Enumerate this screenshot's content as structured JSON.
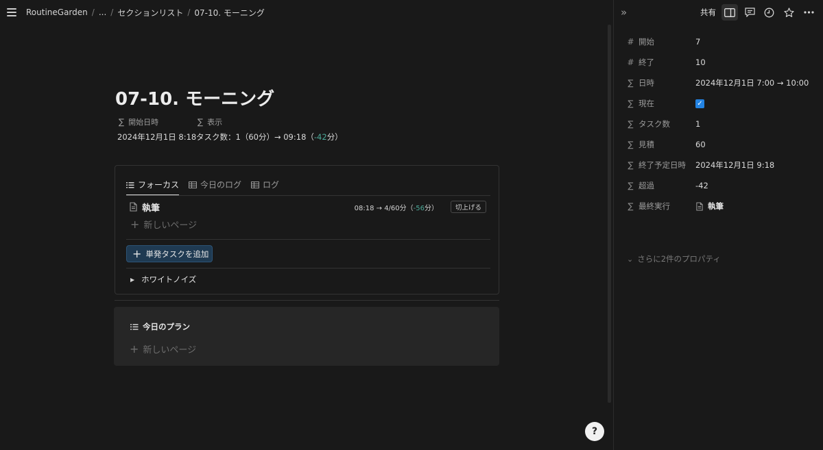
{
  "breadcrumb": [
    "RoutineGarden",
    "...",
    "セクションリスト",
    "07-10. モーニング"
  ],
  "page": {
    "title": "07-10. モーニング",
    "props": [
      {
        "name": "開始日時",
        "value": "2024年12月1日 8:18"
      },
      {
        "name": "表示",
        "value_a": "タスク数：1（60分）→ 09:18（",
        "value_green": "-42",
        "value_b": "分）"
      }
    ]
  },
  "focus_panel": {
    "tabs": [
      "フォーカス",
      "今日のログ",
      "ログ"
    ],
    "task": {
      "name": "執筆",
      "info_a": "08:18 → 4/60分（",
      "info_green": "-56",
      "info_b": "分）",
      "button": "切上げる"
    },
    "new_page": "新しいページ",
    "add_button": "単発タスクを追加",
    "toggle": "ホワイトノイズ"
  },
  "plan_panel": {
    "title": "今日のプラン",
    "new_page": "新しいページ"
  },
  "help_button": "?",
  "right_panel": {
    "share": "共有",
    "properties": [
      {
        "icon": "#",
        "name": "開始",
        "value": "7"
      },
      {
        "icon": "#",
        "name": "終了",
        "value": "10"
      },
      {
        "icon": "∑",
        "name": "日時",
        "value": "2024年12月1日 7:00 → 10:00"
      },
      {
        "icon": "∑",
        "name": "現在",
        "value": "checked"
      },
      {
        "icon": "∑",
        "name": "タスク数",
        "value": "1"
      },
      {
        "icon": "∑",
        "name": "見積",
        "value": "60"
      },
      {
        "icon": "∑",
        "name": "終了予定日時",
        "value": "2024年12月1日 9:18"
      },
      {
        "icon": "∑",
        "name": "超過",
        "value": "-42"
      },
      {
        "icon": "∑",
        "name": "最終実行",
        "value": "執筆"
      }
    ],
    "more": "さらに2件のプロパティ"
  },
  "colors": {
    "background": "#191919",
    "accent_blue": "#2383e2",
    "green": "#4dab9a",
    "add_button_bg": "#1f3a52"
  }
}
